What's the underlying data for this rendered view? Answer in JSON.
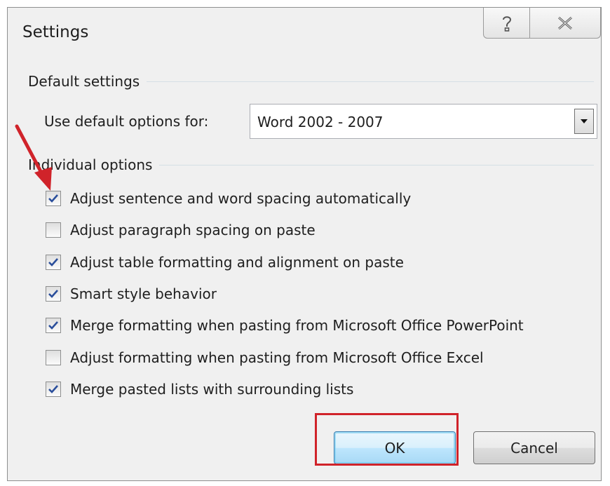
{
  "dialog": {
    "title": "Settings",
    "help_icon": "help-icon",
    "close_icon": "close-icon"
  },
  "default_settings": {
    "group_label": "Default settings",
    "use_default_label": "Use default options for:",
    "selected_value": "Word 2002 - 2007"
  },
  "individual_options": {
    "group_label": "Individual options",
    "items": [
      {
        "label": "Adjust sentence and word spacing automatically",
        "checked": true
      },
      {
        "label": "Adjust paragraph spacing on paste",
        "checked": false
      },
      {
        "label": "Adjust table formatting and alignment on paste",
        "checked": true
      },
      {
        "label": "Smart style behavior",
        "checked": true
      },
      {
        "label": "Merge formatting when pasting from Microsoft Office PowerPoint",
        "checked": true
      },
      {
        "label": "Adjust formatting when pasting from Microsoft Office Excel",
        "checked": false
      },
      {
        "label": "Merge pasted lists with surrounding lists",
        "checked": true
      }
    ]
  },
  "buttons": {
    "ok_label": "OK",
    "cancel_label": "Cancel"
  },
  "colors": {
    "annotation_red": "#d0232a",
    "check_blue": "#2a4e9b"
  }
}
